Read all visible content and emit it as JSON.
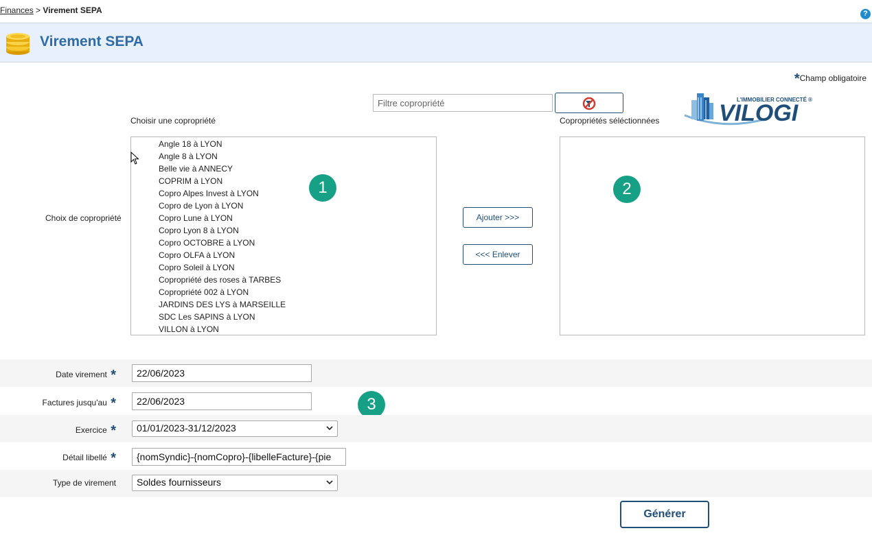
{
  "breadcrumb": {
    "parent": "Finances",
    "separator": ">",
    "current": "Virement SEPA"
  },
  "header": {
    "title": "Virement SEPA",
    "icon": "coins-icon"
  },
  "help": {
    "glyph": "?",
    "icon": "help-icon"
  },
  "required_note": {
    "star": "*",
    "text": "Champ obligatoire"
  },
  "filter": {
    "placeholder": "Filtre copropriété",
    "value": ""
  },
  "logo": {
    "tagline": "L'IMMOBILIER CONNECTÉ ®",
    "brand": "VILOGI"
  },
  "selection": {
    "left_title": "Choisir une copropriété",
    "right_title": "Copropriétés séléctionnées",
    "row_label": "Choix de copropriété",
    "available": [
      "Angle 18 à LYON",
      "Angle 8 à LYON",
      "Belle vie à ANNECY",
      "COPRIM à LYON",
      "Copro Alpes Invest à LYON",
      "Copro de Lyon à LYON",
      "Copro Lune à LYON",
      "Copro Lyon 8 à LYON",
      "Copro OCTOBRE à LYON",
      "Copro OLFA à LYON",
      "Copro Soleil à LYON",
      "Copropriété des roses à TARBES",
      "Copropriété 002 à LYON",
      "JARDINS DES LYS à MARSEILLE",
      "SDC Les SAPINS à LYON",
      "VILLON à LYON"
    ],
    "selected": [],
    "add_label": "Ajouter >>>",
    "remove_label": "<<< Enlever"
  },
  "badges": [
    "1",
    "2",
    "3"
  ],
  "form": {
    "star": "*",
    "date_virement": {
      "label": "Date virement",
      "value": "22/06/2023"
    },
    "factures": {
      "label": "Factures jusqu'au",
      "value": "22/06/2023"
    },
    "exercice": {
      "label": "Exercice",
      "value": "01/01/2023-31/12/2023"
    },
    "detail": {
      "label": "Détail libellé",
      "value": "{nomSyndic}-{nomCopro}-{libelleFacture}-{pie"
    },
    "type": {
      "label": "Type de virement",
      "value": "Soldes fournisseurs"
    }
  },
  "generate_label": "Générer",
  "colors": {
    "accent": "#1f4e79",
    "title": "#2e6ca8",
    "badge": "#16a085",
    "header_bg": "#e8f1fb"
  }
}
